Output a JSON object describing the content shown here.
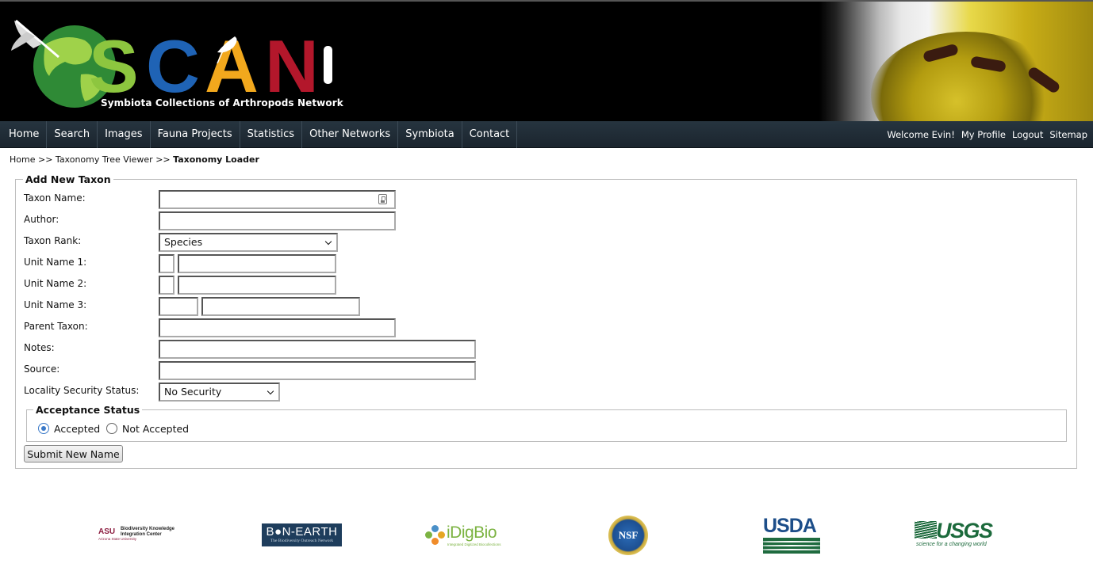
{
  "banner": {
    "logo_text": "SCAN",
    "tagline": "Symbiota Collections of Arthropods Network"
  },
  "nav": {
    "items": [
      "Home",
      "Search",
      "Images",
      "Fauna Projects",
      "Statistics",
      "Other Networks",
      "Symbiota",
      "Contact"
    ],
    "welcome": "Welcome Evin!",
    "my_profile": "My Profile",
    "logout": "Logout",
    "sitemap": "Sitemap"
  },
  "breadcrumb": {
    "home": "Home",
    "sep": ">>",
    "tree_viewer": "Taxonomy Tree Viewer",
    "current": "Taxonomy Loader"
  },
  "form": {
    "legend": "Add New Taxon",
    "taxon_name_label": "Taxon Name:",
    "taxon_name_value": "",
    "author_label": "Author:",
    "author_value": "",
    "rank_label": "Taxon Rank:",
    "rank_selected": "Species",
    "unit1_label": "Unit Name 1:",
    "unit2_label": "Unit Name 2:",
    "unit3_label": "Unit Name 3:",
    "parent_label": "Parent Taxon:",
    "notes_label": "Notes:",
    "source_label": "Source:",
    "security_label": "Locality Security Status:",
    "security_selected": "No Security",
    "acceptance_legend": "Acceptance Status",
    "accepted_label": "Accepted",
    "not_accepted_label": "Not Accepted",
    "accepted_checked": true,
    "submit_label": "Submit New Name"
  },
  "footer": {
    "asu_mark": "ASU",
    "asu_text": "Biodiversity Knowledge Integration Center",
    "asu_sub": "Arizona State University",
    "bon_title": "B●N-EARTH",
    "bon_sub": "The Biodiversity Outreach Network",
    "idigbio_title": "iDigBio",
    "idigbio_sub": "Integrated Digitized Biocollections",
    "nsf": "NSF",
    "usda": "USDA",
    "usgs": "USGS",
    "usgs_sub": "science for a changing world"
  },
  "colors": {
    "nav_bg": "#1e2a33",
    "scan_s": "#8dc63f",
    "scan_c": "#1f63b5",
    "scan_a": "#f2a81d",
    "scan_n": "#b3172b",
    "radio_accent": "#3a79c8"
  }
}
